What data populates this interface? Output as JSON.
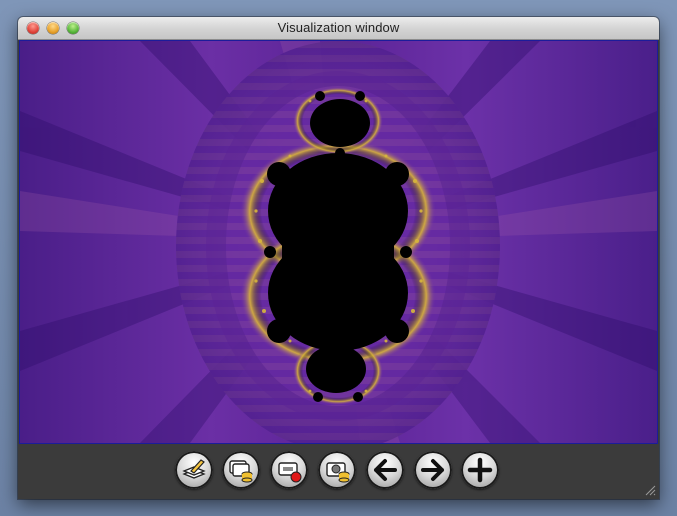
{
  "window": {
    "title": "Visualization window"
  },
  "toolbar": {
    "buttons": [
      {
        "icon": "edit-layers-icon"
      },
      {
        "icon": "save-windows-icon"
      },
      {
        "icon": "record-movie-icon"
      },
      {
        "icon": "save-image-icon"
      },
      {
        "icon": "back-arrow-icon"
      },
      {
        "icon": "forward-arrow-icon"
      },
      {
        "icon": "add-icon"
      }
    ]
  },
  "colors": {
    "fractal_background": "#6a2ca6",
    "fractal_set": "#000000",
    "fractal_edge": "#e8c43a",
    "viewport_border": "#1c1c9a"
  }
}
